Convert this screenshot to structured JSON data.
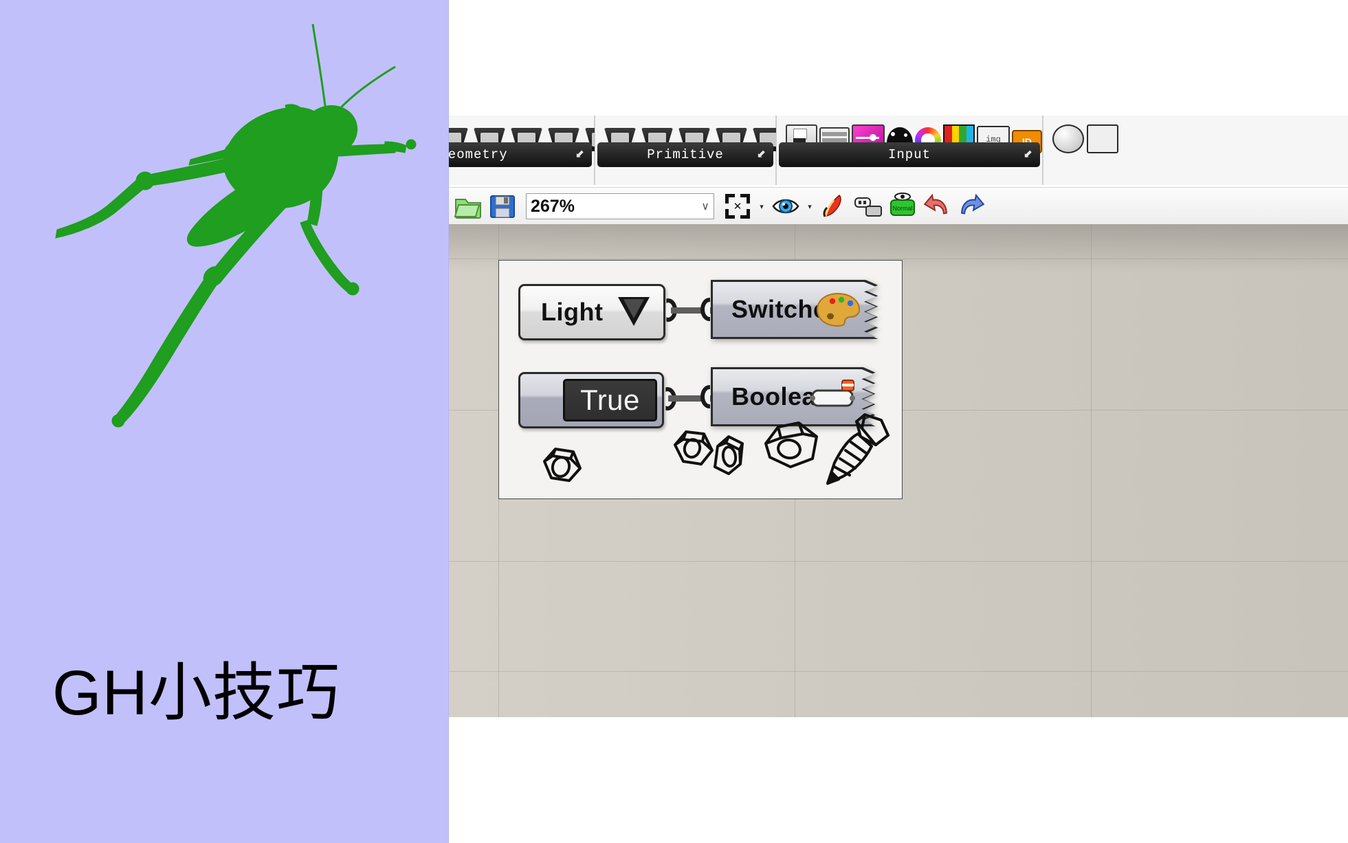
{
  "cover": {
    "title": "GH小技巧",
    "bg_color": "#c2c0fb",
    "logo_name": "grasshopper-silhouette",
    "logo_color": "#1f9e1f"
  },
  "ribbon": {
    "groups": [
      {
        "label": "Geometry",
        "icon_count": 7,
        "arrow": "⬋"
      },
      {
        "label": "Primitive",
        "icon_count": 5,
        "arrow": "⬋"
      },
      {
        "label": "Input",
        "icon_count": 8,
        "arrow": "⬋"
      }
    ]
  },
  "toolbar": {
    "open_label": "open-file",
    "save_label": "save-file",
    "zoom_value": "267%",
    "zoom_dropdown": "∨",
    "buttons": [
      "zoom-extents-icon",
      "dropdown-arrow-icon",
      "preview-eye-icon",
      "dropdown-arrow-icon",
      "preview-mesh-quality-icon",
      "cluster-icon",
      "preview-normal-icon",
      "undo-icon",
      "redo-icon"
    ]
  },
  "canvas": {
    "bg_color": "#d0ccc4",
    "group": {
      "bg_color": "#f4f3f1",
      "border_color": "#4a4a4a"
    },
    "components": [
      {
        "id": "light",
        "kind": "value-list",
        "label": "Light",
        "icon": "dropdown-triangle-icon"
      },
      {
        "id": "switcher",
        "kind": "param",
        "label": "Switcher",
        "icon": "colour-palette-icon"
      },
      {
        "id": "true-toggle",
        "kind": "boolean-toggle",
        "label": "True"
      },
      {
        "id": "boolean",
        "kind": "param",
        "label": "Boolean",
        "icon": "boolean-toggle-icon"
      }
    ],
    "wires": [
      {
        "from": "light",
        "to": "switcher"
      },
      {
        "from": "true-toggle",
        "to": "boolean"
      }
    ],
    "doodles": [
      "hex-nut-icon",
      "two-nuts-icon",
      "hex-nut-large-icon",
      "screw-icon"
    ]
  }
}
